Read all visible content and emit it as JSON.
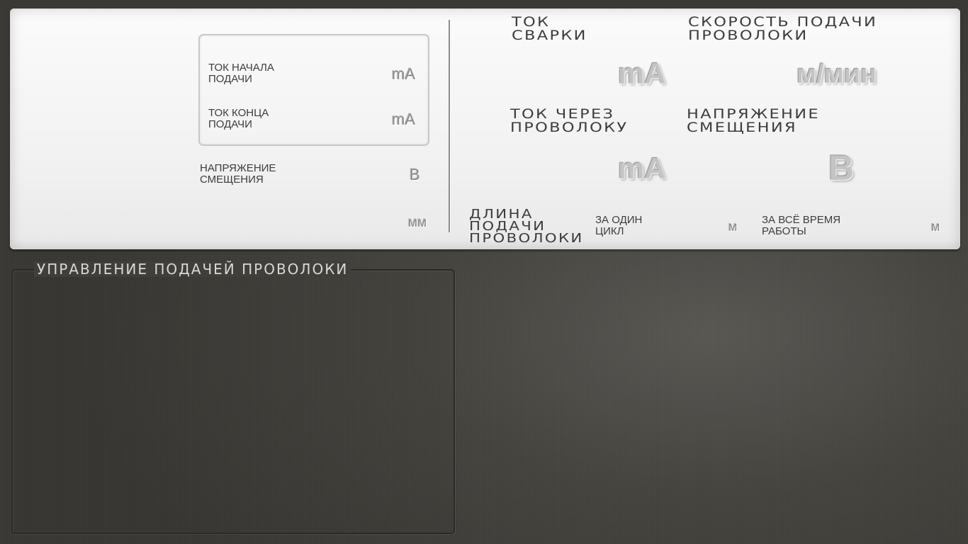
{
  "left_panel": {
    "start_current": {
      "label_line1": "ТОК НАЧАЛА",
      "label_line2": "ПОДАЧИ",
      "unit": "mA"
    },
    "end_current": {
      "label_line1": "ТОК КОНЦА",
      "label_line2": "ПОДАЧИ",
      "unit": "mA"
    },
    "bias_voltage": {
      "label_line1": "НАПРЯЖЕНИЕ",
      "label_line2": "СМЕЩЕНИЯ",
      "unit": "В"
    },
    "length_unit": "мм"
  },
  "right_panel": {
    "welding_current": {
      "label_line1": "ТОК",
      "label_line2": "СВАРКИ",
      "unit": "mA"
    },
    "wire_speed": {
      "label_line1": "СКОРОСТЬ ПОДАЧИ",
      "label_line2": "ПРОВОЛОКИ",
      "unit": "м/мин"
    },
    "wire_current": {
      "label_line1": "ТОК ЧЕРЕЗ",
      "label_line2": "ПРОВОЛОКУ",
      "unit": "mA"
    },
    "bias_voltage": {
      "label_line1": "НАПРЯЖЕНИЕ",
      "label_line2": "СМЕЩЕНИЯ",
      "unit": "В"
    },
    "feed_length": {
      "label_line1": "ДЛИНА",
      "label_line2": "ПОДАЧИ",
      "label_line3": "ПРОВОЛОКИ",
      "per_cycle_line1": "ЗА ОДИН",
      "per_cycle_line2": "ЦИКЛ",
      "per_cycle_unit": "м",
      "total_line1": "ЗА ВСЁ ВРЕМЯ",
      "total_line2": "РАБОТЫ",
      "total_unit": "м"
    }
  },
  "wire_control": {
    "title": "УПРАВЛЕНИЕ ПОДАЧЕЙ ПРОВОЛОКИ"
  },
  "colors": {
    "panel": "#f2f2f2",
    "background": "#46443f",
    "label": "#3d3d3d",
    "unit": "#c4c4c4"
  }
}
